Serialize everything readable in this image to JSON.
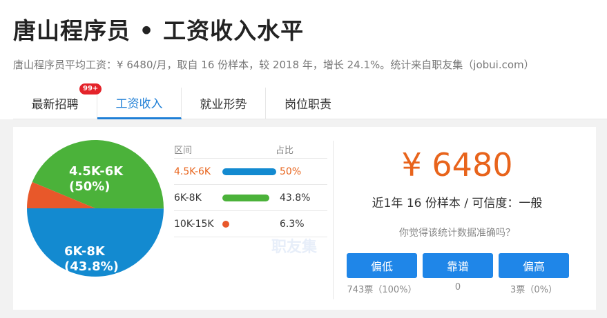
{
  "header": {
    "title": "唐山程序员 • 工资收入水平",
    "subtitle": "唐山程序员平均工资：¥ 6480/月，取自 16 份样本，较 2018 年，增长 24.1%。统计来自职友集（jobui.com）"
  },
  "tabs": [
    {
      "label": "最新招聘",
      "badge": "99+"
    },
    {
      "label": "工资收入"
    },
    {
      "label": "就业形势"
    },
    {
      "label": "岗位职责"
    }
  ],
  "pie": {
    "labels": [
      {
        "range": "4.5K-6K",
        "pct": "(50%)"
      },
      {
        "range": "6K-8K",
        "pct": "(43.8%)"
      }
    ]
  },
  "table": {
    "col_range": "区间",
    "col_share": "占比",
    "rows": [
      {
        "range": "4.5K-6K",
        "share": "50%",
        "value": 50,
        "color": "#138ad0"
      },
      {
        "range": "6K-8K",
        "share": "43.8%",
        "value": 43.8,
        "color": "#4bb23a"
      },
      {
        "range": "10K-15K",
        "share": "6.3%",
        "value": 6.3,
        "color": "#e8582a"
      }
    ]
  },
  "watermark": "职友集",
  "summary": {
    "salary": "¥ 6480",
    "samples": "近1年 16 份样本 / 可信度：一般",
    "question": "你觉得该统计数据准确吗？"
  },
  "votes": [
    {
      "label": "偏低",
      "count": "743票（100%）"
    },
    {
      "label": "靠谱",
      "count": "0"
    },
    {
      "label": "偏高",
      "count": "3票（0%）"
    }
  ],
  "colors": {
    "accent_blue": "#1f86e8",
    "accent_orange": "#e8641c",
    "badge_red": "#e4232a"
  }
}
